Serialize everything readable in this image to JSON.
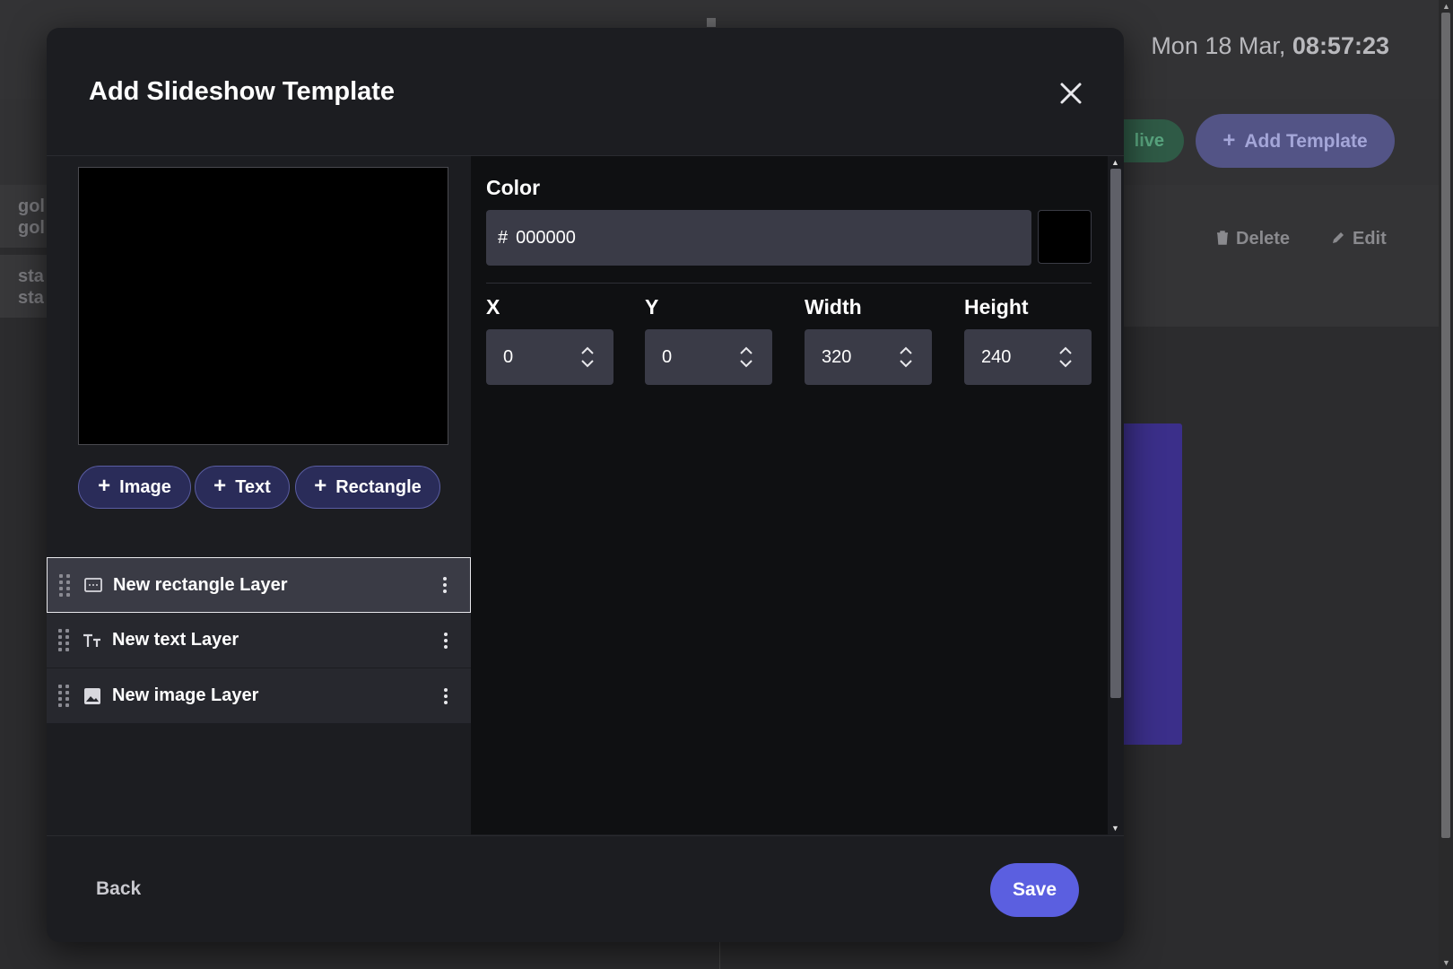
{
  "background": {
    "date_prefix": "Mon 18 Mar,",
    "time": "08:57:23",
    "live_label": "live",
    "add_template_label": "Add Template",
    "rows": [
      {
        "line1": "gol",
        "line2": "gol"
      },
      {
        "line1": "sta",
        "line2": "sta"
      }
    ],
    "delete_label": "Delete",
    "edit_label": "Edit"
  },
  "modal": {
    "title": "Add Slideshow Template",
    "add_buttons": {
      "image": "Image",
      "text": "Text",
      "rectangle": "Rectangle"
    },
    "layers": [
      {
        "label": "New rectangle Layer",
        "icon": "rectangle-layer-icon",
        "selected": true
      },
      {
        "label": "New text Layer",
        "icon": "text-layer-icon",
        "selected": false
      },
      {
        "label": "New image Layer",
        "icon": "image-layer-icon",
        "selected": false
      }
    ],
    "properties": {
      "color_label": "Color",
      "color_hash": "#",
      "color_value": "000000",
      "swatch_color": "#000000",
      "x_label": "X",
      "x_value": "0",
      "y_label": "Y",
      "y_value": "0",
      "width_label": "Width",
      "width_value": "320",
      "height_label": "Height",
      "height_value": "240"
    },
    "footer": {
      "back_label": "Back",
      "save_label": "Save"
    }
  },
  "colors": {
    "accent": "#5b5fe0",
    "pill_bg": "#2a2c59",
    "modal_bg": "#1c1d21"
  }
}
